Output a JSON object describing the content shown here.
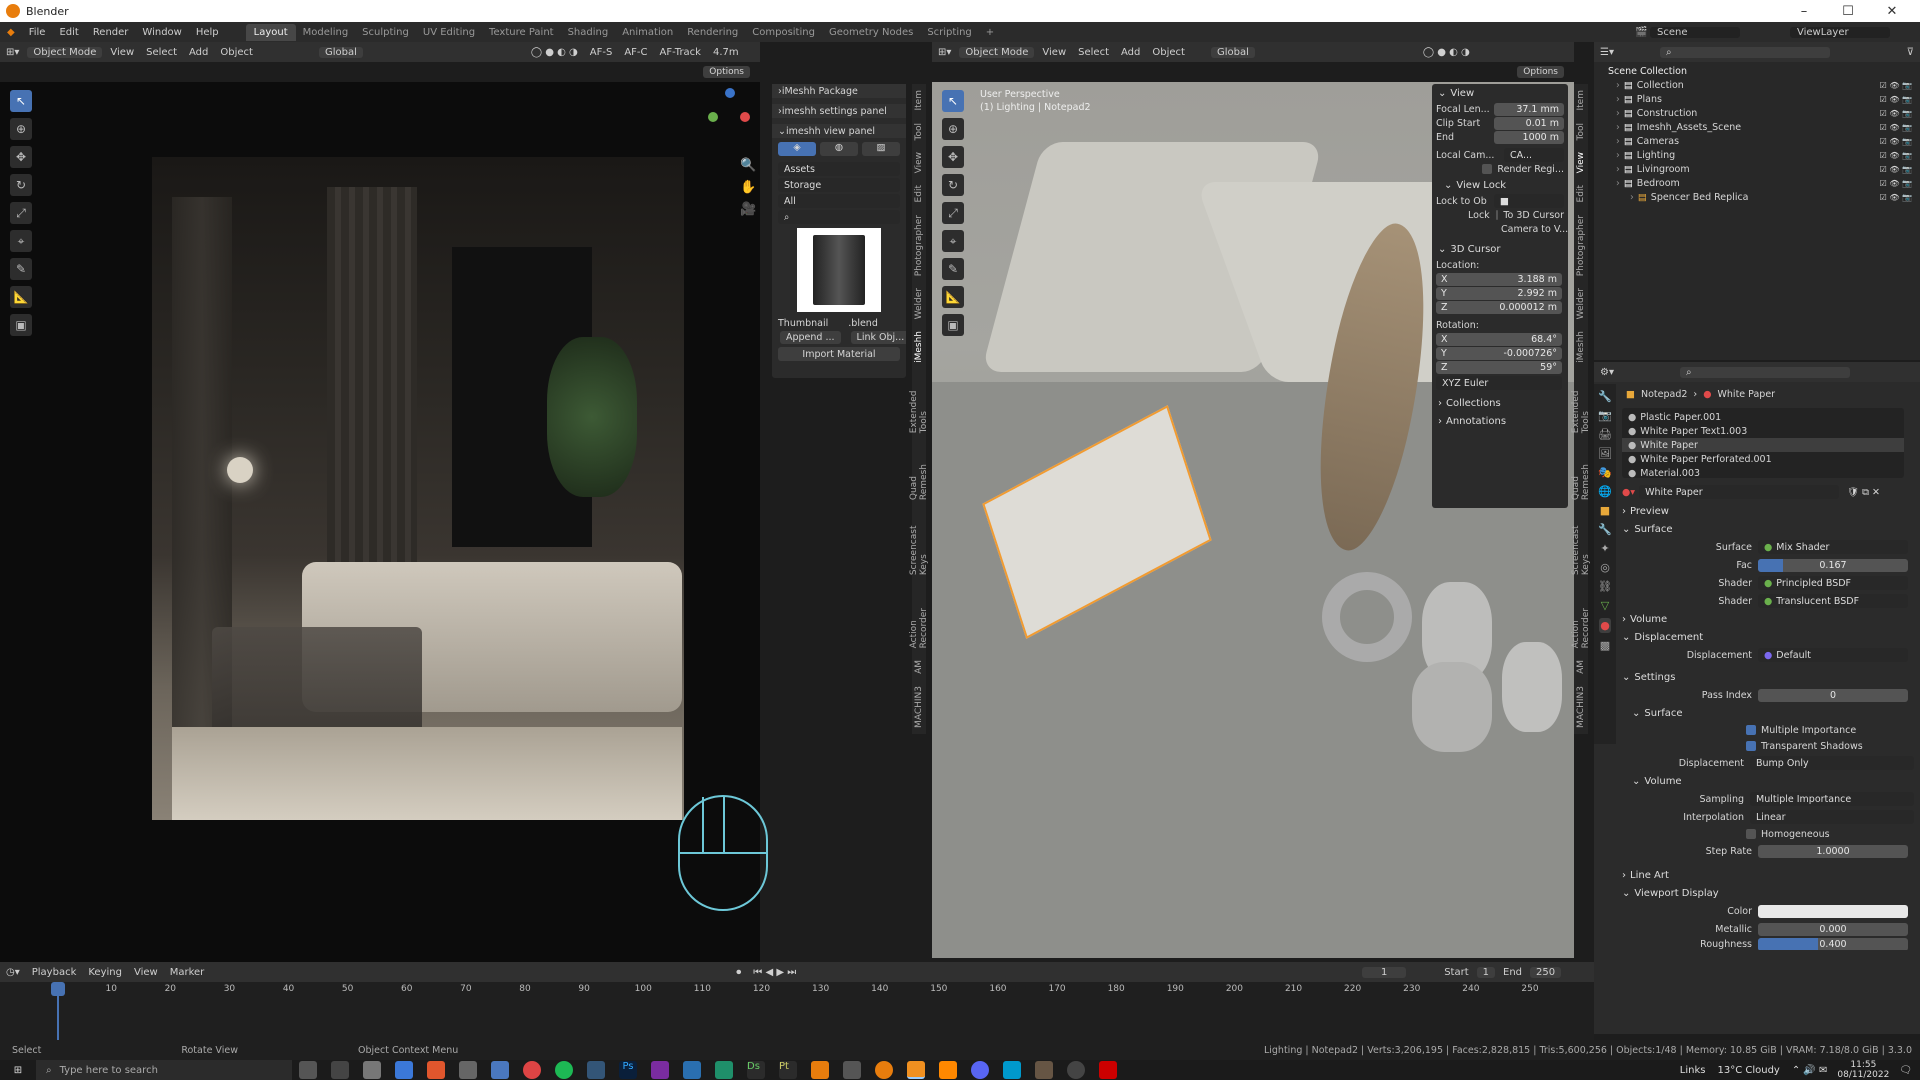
{
  "window": {
    "title": "Blender",
    "min": "–",
    "max": "☐",
    "close": "✕"
  },
  "menu": {
    "file": "File",
    "edit": "Edit",
    "render": "Render",
    "window": "Window",
    "help": "Help"
  },
  "workspaces": [
    "Layout",
    "Modeling",
    "Sculpting",
    "UV Editing",
    "Texture Paint",
    "Shading",
    "Animation",
    "Rendering",
    "Compositing",
    "Geometry Nodes",
    "Scripting",
    "+"
  ],
  "scene": {
    "icon_label": "Scene",
    "name": "Scene",
    "view_layer": "ViewLayer"
  },
  "left_view": {
    "mode": "Object Mode",
    "view": "View",
    "select": "Select",
    "add": "Add",
    "object": "Object",
    "transform": "Global",
    "af_s": "AF-S",
    "af_c": "AF-C",
    "af_track": "AF-Track",
    "focal": "4.7m",
    "options": "Options"
  },
  "imeshh": {
    "package": "iMeshh Package",
    "settings": "imeshh settings panel",
    "view_panel": "imeshh view panel",
    "assets": "Assets",
    "storage": "Storage",
    "all": "All",
    "thumbnail": "Thumbnail",
    "blend": ".blend",
    "append": "Append ...",
    "link": "Link Obj...",
    "import_material": "Import Material"
  },
  "left_tabs": [
    "Item",
    "Tool",
    "View",
    "Edit",
    "Photographer",
    "Welder",
    "iMeshh",
    "Extended Tools",
    "Quad Remesh",
    "Screencast Keys",
    "Action Recorder",
    "AM",
    "MACHIN3"
  ],
  "right_view": {
    "mode": "Object Mode",
    "view": "View",
    "select": "Select",
    "add": "Add",
    "object": "Object",
    "transform": "Global",
    "options": "Options",
    "persp": "User Perspective",
    "info": "(1) Lighting | Notepad2"
  },
  "npanel": {
    "view": "View",
    "focal_label": "Focal Len...",
    "focal": "37.1 mm",
    "clip_start_label": "Clip Start",
    "clip_start": "0.01 m",
    "end_label": "End",
    "end": "1000 m",
    "local_cam": "Local Cam...",
    "local_cam_val": "CA...",
    "render_region": "Render Regi...",
    "view_lock": "View Lock",
    "lock_to_ob": "Lock to Ob",
    "lock": "Lock",
    "to_3d_cursor": "To 3D Cursor",
    "camera_to_v": "Camera to V...",
    "cursor": "3D Cursor",
    "location": "Location:",
    "x": "X",
    "y": "Y",
    "z": "Z",
    "loc_x": "3.188 m",
    "loc_y": "2.992 m",
    "loc_z": "0.000012 m",
    "rotation": "Rotation:",
    "rot_x": "68.4°",
    "rot_y": "-0.000726°",
    "rot_z": "59°",
    "euler": "XYZ Euler",
    "collections": "Collections",
    "annotations": "Annotations"
  },
  "right_tabs": [
    "Item",
    "Tool",
    "View",
    "Edit",
    "Photographer",
    "Welder",
    "iMeshh",
    "Extended Tools",
    "Quad Remesh",
    "Screencast Keys",
    "Action Recorder",
    "AM",
    "MACHIN3"
  ],
  "outliner": {
    "root": "Scene Collection",
    "items": [
      {
        "name": "Collection",
        "indent": 0
      },
      {
        "name": "Plans",
        "indent": 0
      },
      {
        "name": "Construction",
        "indent": 0
      },
      {
        "name": "Imeshh_Assets_Scene",
        "indent": 0
      },
      {
        "name": "Cameras",
        "indent": 0
      },
      {
        "name": "Lighting",
        "indent": 0
      },
      {
        "name": "Livingroom",
        "indent": 0
      },
      {
        "name": "Bedroom",
        "indent": 0
      },
      {
        "name": "Spencer Bed Replica",
        "indent": 1
      }
    ]
  },
  "props": {
    "object": "Notepad2",
    "material": "White Paper",
    "slots": [
      "Plastic Paper.001",
      "White Paper Text1.003",
      "White Paper",
      "White Paper Perforated.001",
      "Material.003"
    ],
    "mat_name": "White Paper",
    "preview": "Preview",
    "surface": "Surface",
    "surface_label": "Surface",
    "surface_val": "Mix Shader",
    "fac_label": "Fac",
    "fac": "0.167",
    "shader1_label": "Shader",
    "shader1": "Principled BSDF",
    "shader2_label": "Shader",
    "shader2": "Translucent BSDF",
    "volume": "Volume",
    "displacement": "Displacement",
    "disp_label": "Displacement",
    "disp_val": "Default",
    "settings": "Settings",
    "pass_index_label": "Pass Index",
    "pass_index": "0",
    "surface_sub": "Surface",
    "multi_imp": "Multiple Importance",
    "transp_shadows": "Transparent Shadows",
    "disp2_label": "Displacement",
    "disp2_val": "Bump Only",
    "volume_sub": "Volume",
    "sampling_label": "Sampling",
    "sampling": "Multiple Importance",
    "interp_label": "Interpolation",
    "interp": "Linear",
    "homogeneous": "Homogeneous",
    "step_label": "Step Rate",
    "step": "1.0000",
    "line_art": "Line Art",
    "viewport_display": "Viewport Display",
    "color_label": "Color",
    "metallic_label": "Metallic",
    "metallic": "0.000",
    "roughness_label": "Roughness",
    "roughness": "0.400"
  },
  "timeline": {
    "playback": "Playback",
    "keying": "Keying",
    "view": "View",
    "marker": "Marker",
    "frame": "1",
    "start_label": "Start",
    "start": "1",
    "end_label": "End",
    "end": "250",
    "ticks": [
      "1",
      "10",
      "20",
      "30",
      "40",
      "50",
      "60",
      "70",
      "80",
      "90",
      "100",
      "110",
      "120",
      "130",
      "140",
      "150",
      "160",
      "170",
      "180",
      "190",
      "200",
      "210",
      "220",
      "230",
      "240",
      "250"
    ]
  },
  "status": {
    "select": "Select",
    "rotate": "Rotate View",
    "ctx": "Object Context Menu",
    "stats": "Lighting | Notepad2 | Verts:3,206,195 | Faces:2,828,815 | Tris:5,600,256 | Objects:1/48 | Memory: 10.85 GiB | VRAM: 7.18/8.0 GiB | 3.3.0"
  },
  "taskbar": {
    "search": "Type here to search",
    "links": "Links",
    "weather": "13°C  Cloudy",
    "time": "11:55",
    "date": "08/11/2022"
  },
  "colors": {
    "accent": "#4772b3",
    "orange": "#e87d0d",
    "panel": "#2b2b2b"
  }
}
